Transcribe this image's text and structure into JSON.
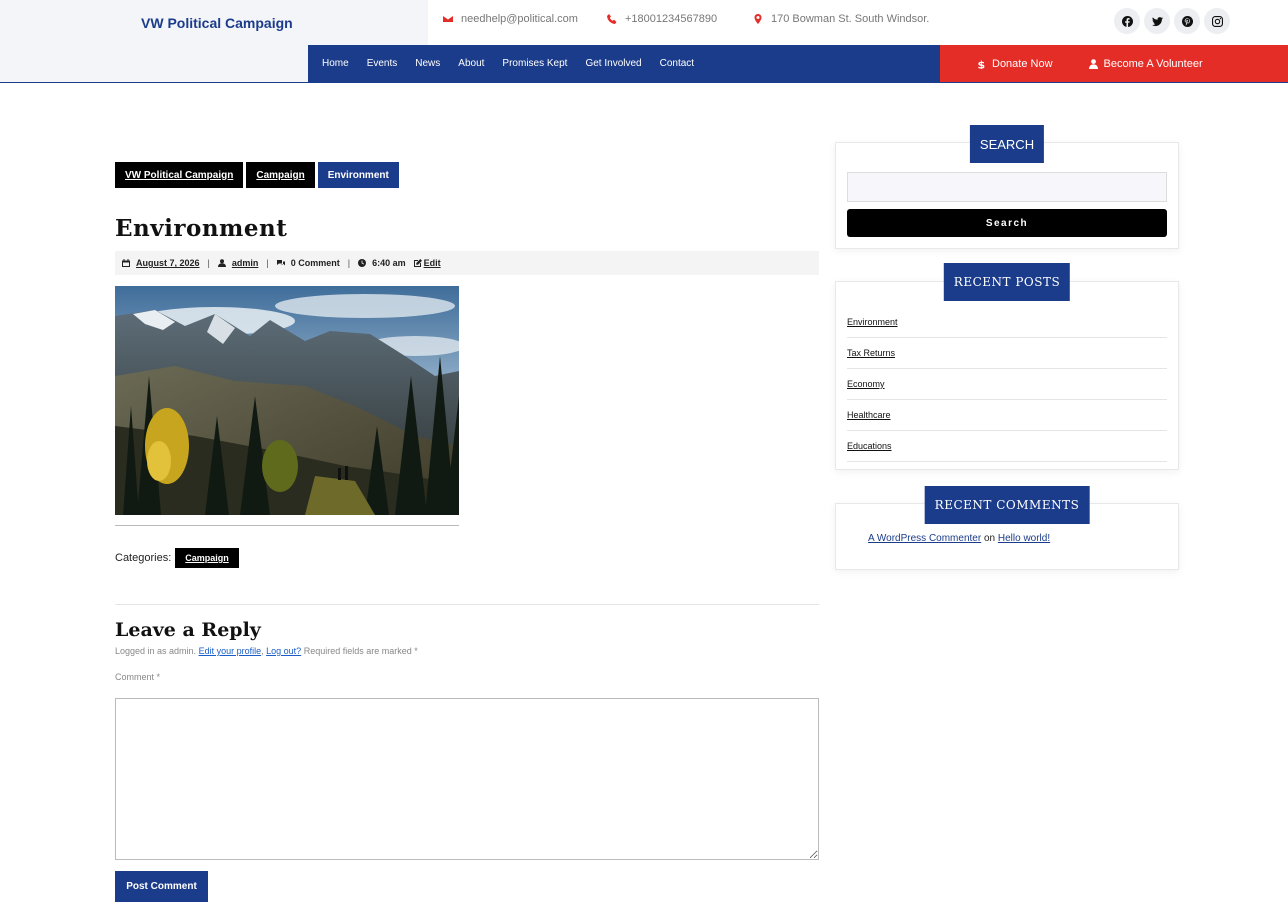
{
  "site": {
    "brand": "VW Political Campaign"
  },
  "topbar": {
    "email": "needhelp@political.com",
    "phone": "+18001234567890",
    "address": "170 Bowman St. South Windsor."
  },
  "social": [
    "facebook-icon",
    "twitter-icon",
    "pinterest-icon",
    "instagram-icon"
  ],
  "nav": {
    "items": [
      {
        "label": "Home"
      },
      {
        "label": "Events"
      },
      {
        "label": "News"
      },
      {
        "label": "About"
      },
      {
        "label": "Promises Kept"
      },
      {
        "label": "Get Involved"
      },
      {
        "label": "Contact"
      }
    ],
    "donate": "Donate Now",
    "volunteer": "Become A Volunteer"
  },
  "breadcrumb": [
    {
      "label": "VW Political Campaign"
    },
    {
      "label": "Campaign"
    },
    {
      "label": "Environment"
    }
  ],
  "post": {
    "title": "Environment",
    "date": "August 7, 2026",
    "author": "admin",
    "comments": "0 Comment",
    "time": "6:40 am",
    "edit": "Edit",
    "categories_label": "Categories:",
    "category": "Campaign"
  },
  "reply": {
    "title": "Leave a Reply",
    "logged_prefix": "Logged in as admin.",
    "edit_profile": "Edit your profile",
    "logout": "Log out?",
    "required": "Required fields are marked *",
    "comment_label": "Comment *",
    "submit": "Post Comment"
  },
  "sidebar": {
    "search": {
      "title": "SEARCH",
      "button": "Search",
      "value": ""
    },
    "recent_posts": {
      "title": "RECENT POSTS",
      "items": [
        {
          "label": "Environment"
        },
        {
          "label": "Tax Returns"
        },
        {
          "label": "Economy"
        },
        {
          "label": "Healthcare"
        },
        {
          "label": "Educations"
        }
      ]
    },
    "recent_comments": {
      "title": "RECENT COMMENTS",
      "author": "A WordPress Commenter",
      "on": "on",
      "post": "Hello world!"
    }
  },
  "colors": {
    "primary": "#1b3c8a",
    "accent": "#e52d27"
  }
}
